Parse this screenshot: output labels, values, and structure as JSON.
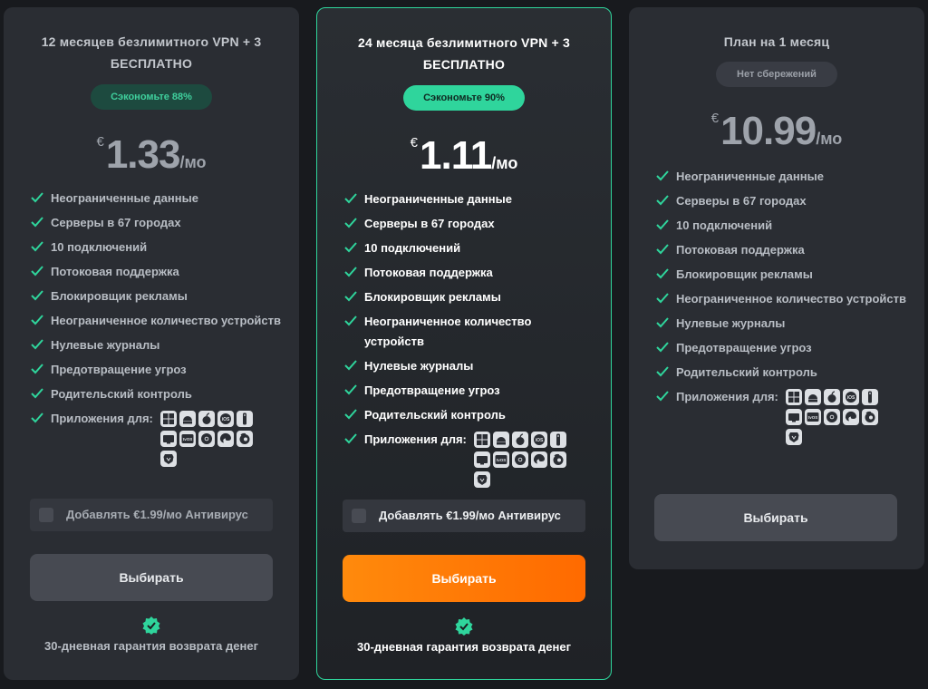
{
  "plans": [
    {
      "title": "12 месяцев безлимитного VPN + 3 БЕСПЛАТНО",
      "badge": "Сэкономьте 88%",
      "currency": "€",
      "amount": "1.33",
      "period": "/мо",
      "addon_label": "Добавлять €1.99/мо Антивирус",
      "button_label": "Выбирать",
      "guarantee": "30-дневная гарантия возврата денег"
    },
    {
      "title": "24 месяца безлимитного VPN + 3 БЕСПЛАТНО",
      "badge": "Сэкономьте 90%",
      "currency": "€",
      "amount": "1.11",
      "period": "/мо",
      "addon_label": "Добавлять €1.99/мо Антивирус",
      "button_label": "Выбирать",
      "guarantee": "30-дневная гарантия возврата денег",
      "highlighted": true
    },
    {
      "title": "План на 1 месяц",
      "badge": "Нет сбережений",
      "currency": "€",
      "amount": "10.99",
      "period": "/мо",
      "button_label": "Выбирать"
    }
  ],
  "features": [
    "Неограниченные данные",
    "Серверы в 67  городах",
    "10 подключений",
    "Потоковая поддержка",
    "Блокировщик рекламы",
    "Неограниченное количество устройств",
    "Нулевые журналы",
    "Предотвращение угроз",
    "Родительский контроль"
  ],
  "apps_label": "Приложения для:",
  "app_icons": [
    "windows-icon",
    "android-icon",
    "apple-icon",
    "ios-icon",
    "remote-icon",
    "android-tv-icon",
    "tvos-icon",
    "chrome-icon",
    "edge-icon",
    "firefox-icon",
    "brave-icon"
  ],
  "app_text": {
    "ios": "iOS",
    "tvos": "tvOS"
  },
  "colors": {
    "accent_green": "#2fd59c",
    "button_orange": "#ff7a00",
    "card_bg": "#2a2d33",
    "page_bg": "#181a1e"
  }
}
